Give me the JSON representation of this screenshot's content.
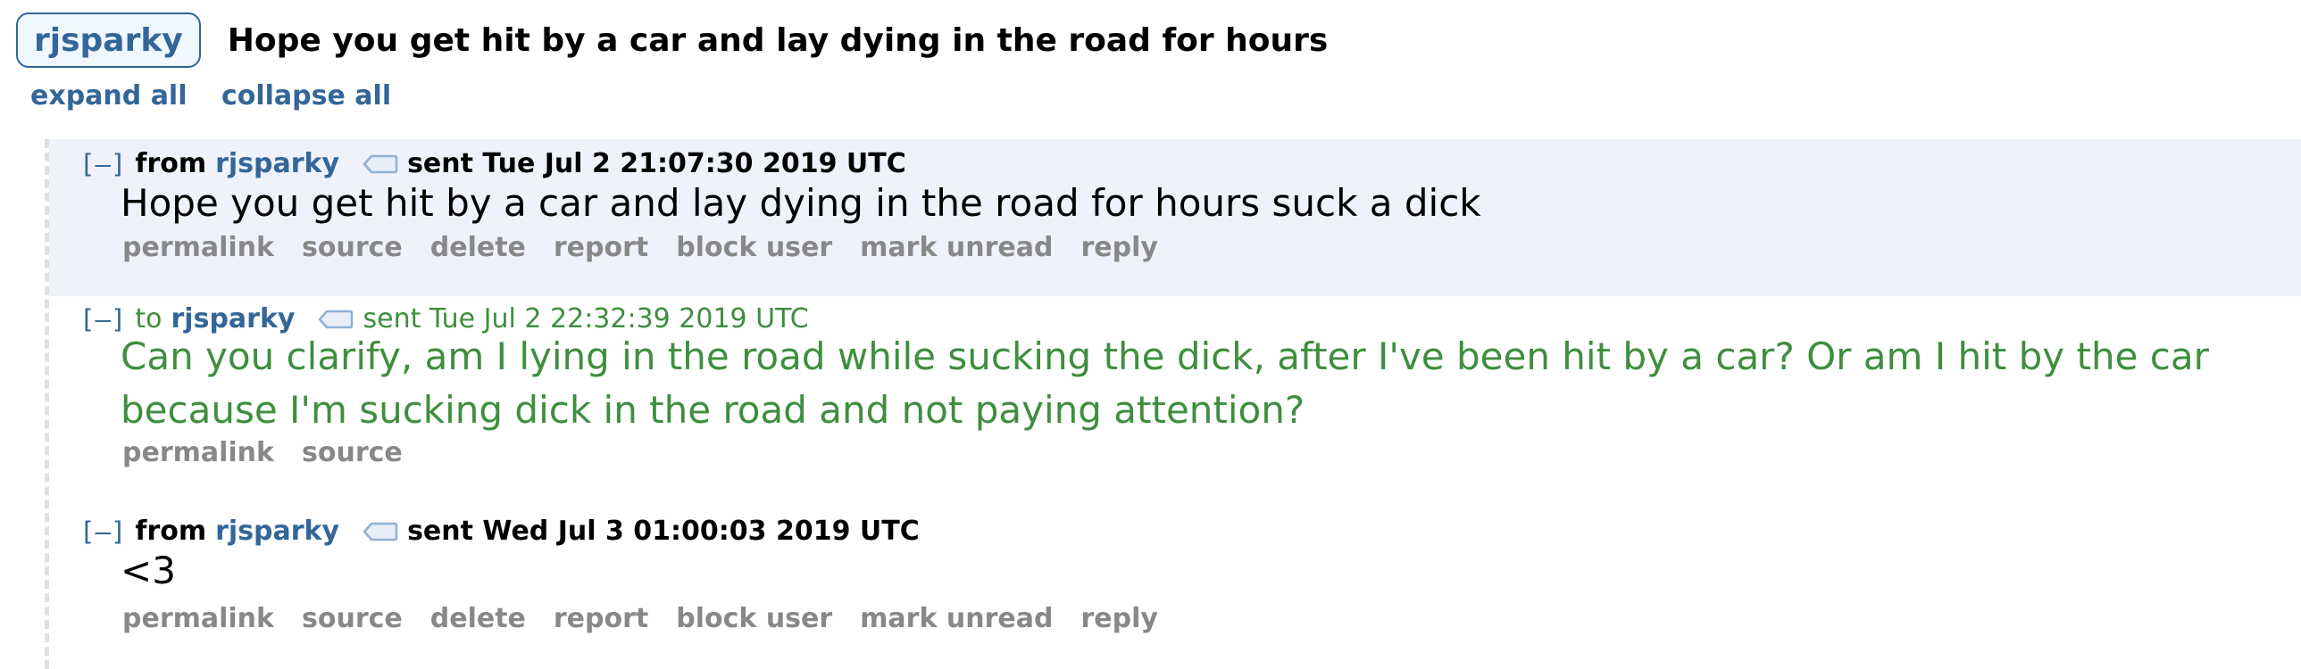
{
  "header": {
    "user_label": "rjsparky",
    "subject": "Hope you get hit by a car and lay dying in the road for hours"
  },
  "controls": {
    "expand_all": "expand all",
    "collapse_all": "collapse all"
  },
  "messages": [
    {
      "toggle": "[–]",
      "direction": "from",
      "author": "rjsparky",
      "sent": "sent Tue Jul 2 21:07:30 2019 UTC",
      "body": "Hope you get hit by a car and lay dying in the road for hours suck a dick",
      "actions": [
        "permalink",
        "source",
        "delete",
        "report",
        "block user",
        "mark unread",
        "reply"
      ]
    },
    {
      "toggle": "[–]",
      "direction": "to",
      "author": "rjsparky",
      "sent": "sent Tue Jul 2 22:32:39 2019 UTC",
      "body": "Can you clarify, am I lying in the road while sucking the dick, after I've been hit by a car? Or am I hit by the car because I'm sucking dick in the road and not paying attention?",
      "actions": [
        "permalink",
        "source"
      ]
    },
    {
      "toggle": "[–]",
      "direction": "from",
      "author": "rjsparky",
      "sent": "sent Wed Jul 3 01:00:03 2019 UTC",
      "body": "<3",
      "actions": [
        "permalink",
        "source",
        "delete",
        "report",
        "block user",
        "mark unread",
        "reply"
      ]
    }
  ],
  "colors": {
    "link_blue": "#336699",
    "sent_green": "#3e8e3e",
    "action_gray": "#888888",
    "highlight_bg": "#eff2fb"
  },
  "icons": {
    "tag": "tag-icon"
  }
}
